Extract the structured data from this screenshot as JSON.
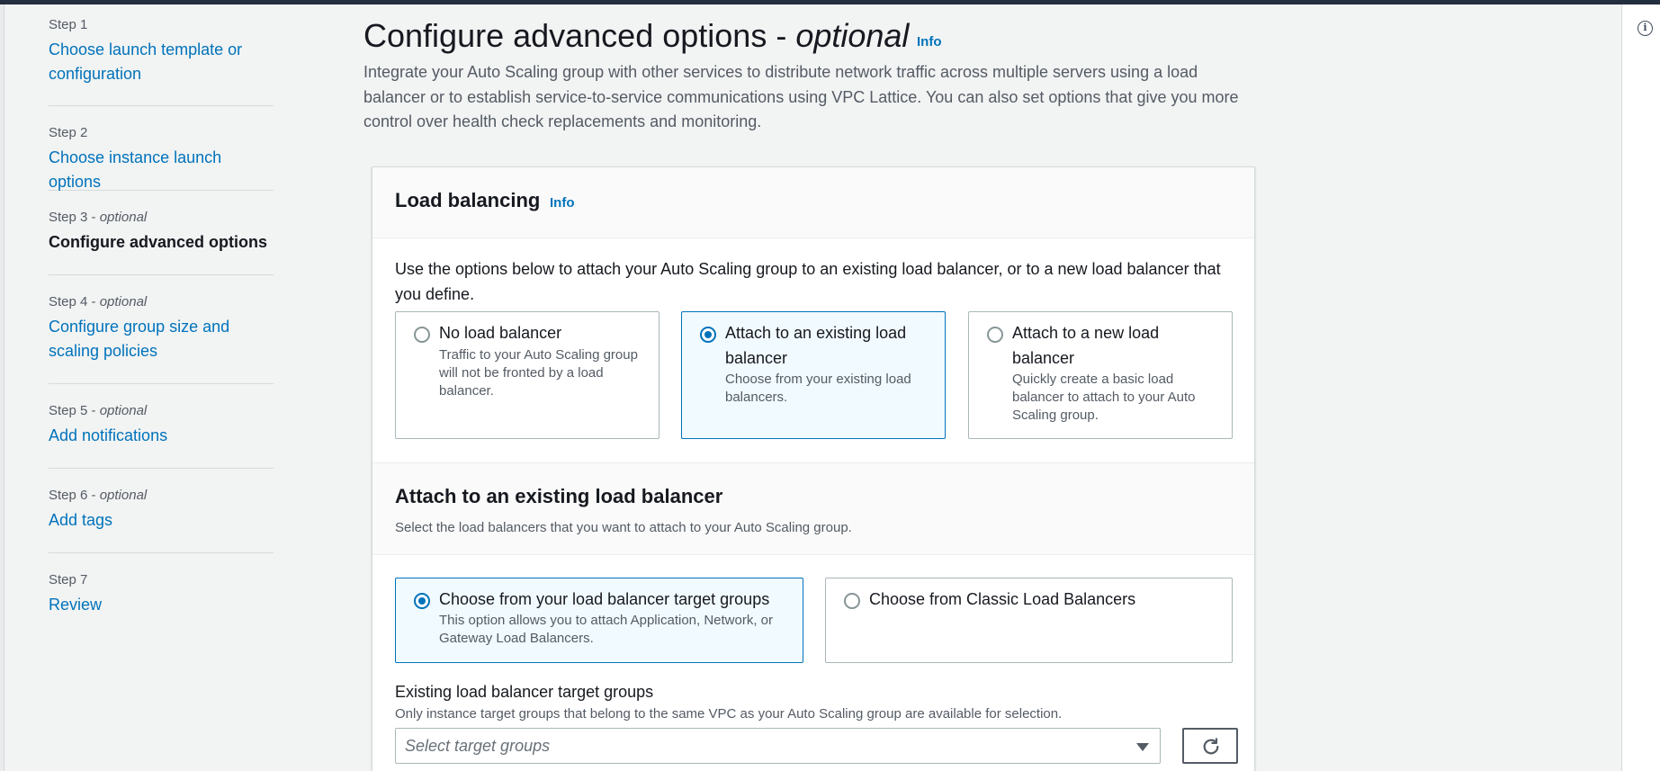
{
  "sidebar": {
    "steps": [
      {
        "label": "Step 1",
        "optional": "",
        "title": "Choose launch template or configuration"
      },
      {
        "label": "Step 2",
        "optional": "",
        "title": "Choose instance launch options"
      },
      {
        "label": "Step 3 - ",
        "optional": "optional",
        "title": "Configure advanced options"
      },
      {
        "label": "Step 4 - ",
        "optional": "optional",
        "title": "Configure group size and scaling policies"
      },
      {
        "label": "Step 5 - ",
        "optional": "optional",
        "title": "Add notifications"
      },
      {
        "label": "Step 6 - ",
        "optional": "optional",
        "title": "Add tags"
      },
      {
        "label": "Step 7",
        "optional": "",
        "title": "Review"
      }
    ]
  },
  "header": {
    "title": "Configure advanced options - ",
    "title_optional": "optional",
    "info": "Info",
    "description": "Integrate your Auto Scaling group with other services to distribute network traffic across multiple servers using a load balancer or to establish service-to-service communications using VPC Lattice. You can also set options that give you more control over health check replacements and monitoring."
  },
  "load_balancing": {
    "title": "Load balancing",
    "info": "Info",
    "description": "Use the options below to attach your Auto Scaling group to an existing load balancer, or to a new load balancer that you define.",
    "options": [
      {
        "label": "No load balancer",
        "description": "Traffic to your Auto Scaling group will not be fronted by a load balancer.",
        "selected": false
      },
      {
        "label": "Attach to an existing load balancer",
        "description": "Choose from your existing load balancers.",
        "selected": true
      },
      {
        "label": "Attach to a new load balancer",
        "description": "Quickly create a basic load balancer to attach to your Auto Scaling group.",
        "selected": false
      }
    ]
  },
  "existing_lb": {
    "title": "Attach to an existing load balancer",
    "description": "Select the load balancers that you want to attach to your Auto Scaling group.",
    "options": [
      {
        "label": "Choose from your load balancer target groups",
        "description": "This option allows you to attach Application, Network, or Gateway Load Balancers.",
        "selected": true
      },
      {
        "label": "Choose from Classic Load Balancers",
        "description": "",
        "selected": false
      }
    ],
    "target_groups": {
      "label": "Existing load balancer target groups",
      "description": "Only instance target groups that belong to the same VPC as your Auto Scaling group are available for selection.",
      "placeholder": "Select target groups"
    }
  },
  "colors": {
    "accent": "#0073bb",
    "topbar": "#232f3e",
    "selected_bg": "#f1faff"
  }
}
